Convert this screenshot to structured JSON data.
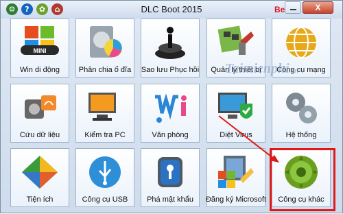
{
  "window": {
    "title": "DLC Boot 2015",
    "beta_label": "Beta",
    "close_label": "X"
  },
  "title_icons": [
    {
      "name": "settings-icon",
      "glyph": "⚙",
      "color": "#2e7d32"
    },
    {
      "name": "help-icon",
      "glyph": "?",
      "color": "#1565c0"
    },
    {
      "name": "gear-icon",
      "glyph": "✿",
      "color": "#6aa02b"
    },
    {
      "name": "home-icon",
      "glyph": "⌂",
      "color": "#b03a2e"
    }
  ],
  "tiles": [
    {
      "name": "tile-win-mini",
      "label": "Win di động",
      "icon": "windows-mini-icon"
    },
    {
      "name": "tile-partition",
      "label": "Phân chia ổ đĩa",
      "icon": "disk-partition-icon"
    },
    {
      "name": "tile-backup",
      "label": "Sao lưu Phục hồi",
      "icon": "backup-restore-icon"
    },
    {
      "name": "tile-device-manager",
      "label": "Quản lý thiết bị",
      "icon": "device-manager-icon"
    },
    {
      "name": "tile-network",
      "label": "Công cụ mạng",
      "icon": "network-icon"
    },
    {
      "name": "tile-data-recovery",
      "label": "Cứu dữ liệu",
      "icon": "data-recovery-icon"
    },
    {
      "name": "tile-pc-check",
      "label": "Kiểm tra PC",
      "icon": "pc-check-icon"
    },
    {
      "name": "tile-office",
      "label": "Văn phòng",
      "icon": "office-icon"
    },
    {
      "name": "tile-antivirus",
      "label": "Diệt Virus",
      "icon": "antivirus-icon"
    },
    {
      "name": "tile-system",
      "label": "Hệ thống",
      "icon": "system-gears-icon"
    },
    {
      "name": "tile-utilities",
      "label": "Tiện ích",
      "icon": "utilities-icon"
    },
    {
      "name": "tile-usb",
      "label": "Công cụ USB",
      "icon": "usb-icon"
    },
    {
      "name": "tile-password",
      "label": "Phá mật khẩu",
      "icon": "password-icon"
    },
    {
      "name": "tile-register-ms",
      "label": "Đăng ký Microsoft",
      "icon": "microsoft-icon"
    },
    {
      "name": "tile-other-tools",
      "label": "Công cụ khác",
      "icon": "other-tools-gear-icon"
    }
  ],
  "watermark": "Taimienphi",
  "watermark_suffix": ".vn",
  "accent_colors": {
    "highlight": "#e01818",
    "tile_border": "#9bb2cc"
  }
}
